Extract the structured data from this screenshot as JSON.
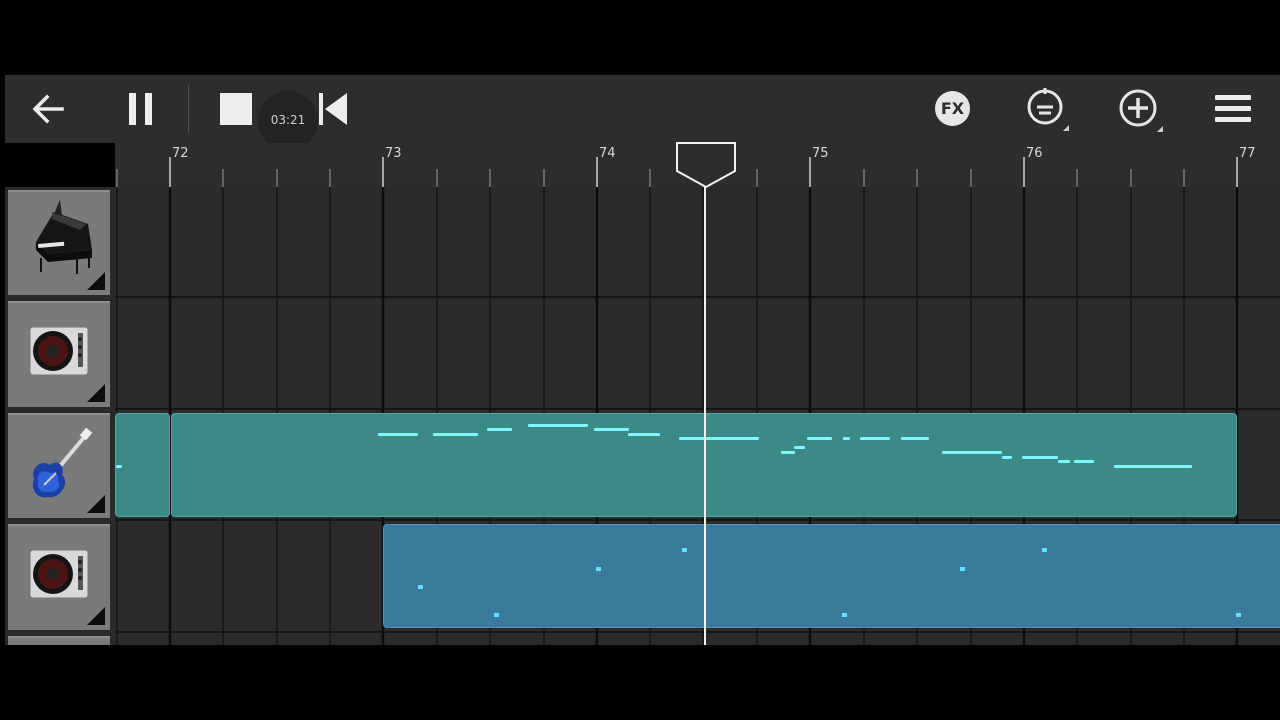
{
  "toolbar": {
    "back_icon": "arrow-left-icon",
    "pause_icon": "pause-icon",
    "stop_icon": "stop-icon",
    "rewind_icon": "skip-to-start-icon",
    "time": "03:21",
    "fx_label": "FX",
    "tempo_icon": "metronome-dial-icon",
    "add_icon": "plus-circle-icon",
    "menu_icon": "hamburger-menu-icon"
  },
  "ruler": {
    "bars": [
      "72",
      "73",
      "74",
      "75",
      "76",
      "77"
    ]
  },
  "tracks": [
    {
      "instrument": "grand-piano-icon"
    },
    {
      "instrument": "dj-turntable-icon"
    },
    {
      "instrument": "electric-guitar-icon"
    },
    {
      "instrument": "dj-turntable-icon"
    }
  ],
  "colors": {
    "background": "#2d2d2d",
    "guitar_region": "#3c8a86",
    "dj_region": "#3a7a9b",
    "note": "#7ff6ff",
    "playhead": "#f2f2f2"
  }
}
